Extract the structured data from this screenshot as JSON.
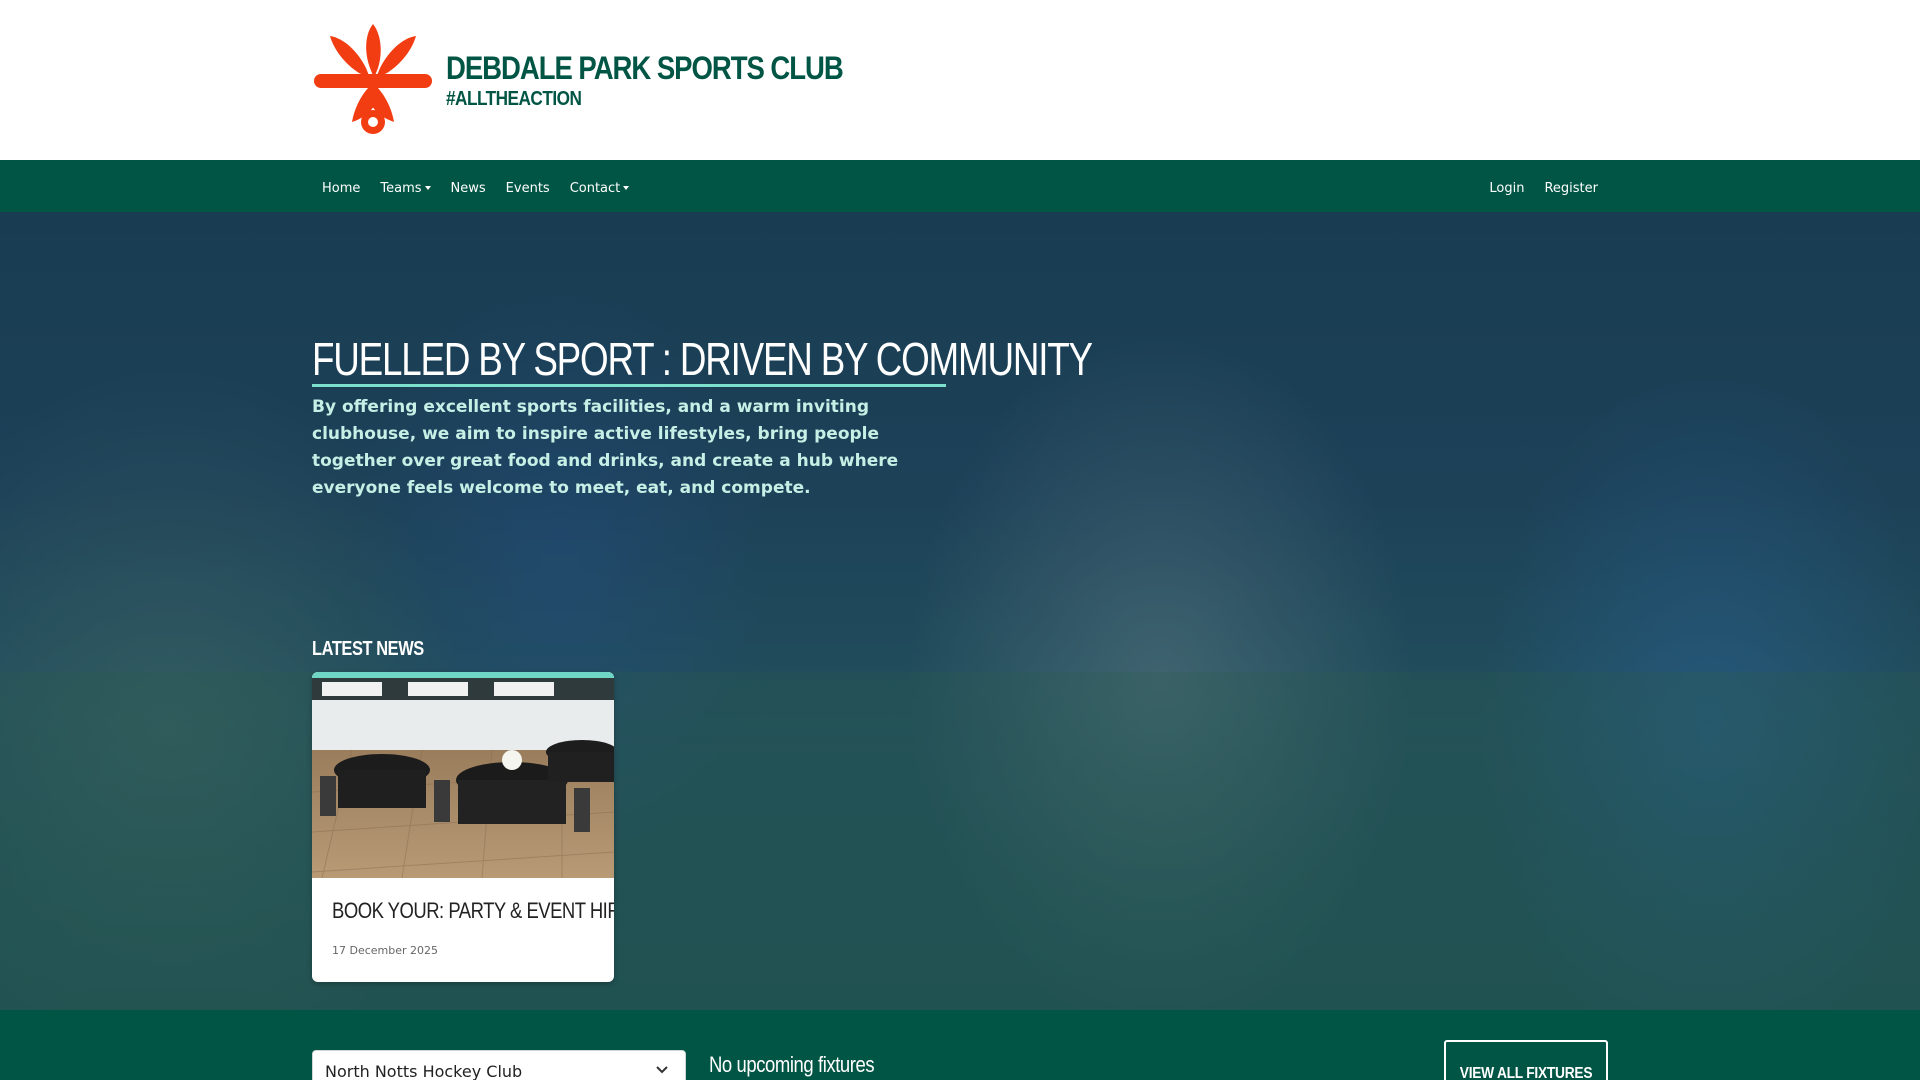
{
  "brand": {
    "name": "DEBDALE PARK SPORTS CLUB",
    "tagline": "#ALLTHEACTION",
    "logo_icon": "club-logo-icon",
    "logo_color": "#f23c12",
    "text_color": "#005544"
  },
  "nav": {
    "left": [
      {
        "label": "Home",
        "dropdown": false
      },
      {
        "label": "Teams",
        "dropdown": true
      },
      {
        "label": "News",
        "dropdown": false
      },
      {
        "label": "Events",
        "dropdown": false
      },
      {
        "label": "Contact",
        "dropdown": true
      }
    ],
    "right": [
      {
        "label": "Login"
      },
      {
        "label": "Register"
      }
    ],
    "background": "#005544"
  },
  "hero": {
    "title": "FUELLED BY SPORT : DRIVEN BY COMMUNITY",
    "text": "By offering excellent sports facilities, and a warm inviting clubhouse, we aim to inspire active lifestyles, bring people together over great food and drinks, and create a hub where everyone feels welcome to meet, eat, and compete.",
    "accent_color": "#7ce0cc"
  },
  "latest_news": {
    "heading": "LATEST NEWS",
    "items": [
      {
        "title": "BOOK YOUR: PARTY & EVENT HIRE",
        "date": "17 December 2025"
      }
    ]
  },
  "fixtures": {
    "club_select": {
      "selected": "North Notts Hockey Club"
    },
    "empty_message": "No upcoming fixtures",
    "view_all_label": "VIEW ALL FIXTURES"
  }
}
